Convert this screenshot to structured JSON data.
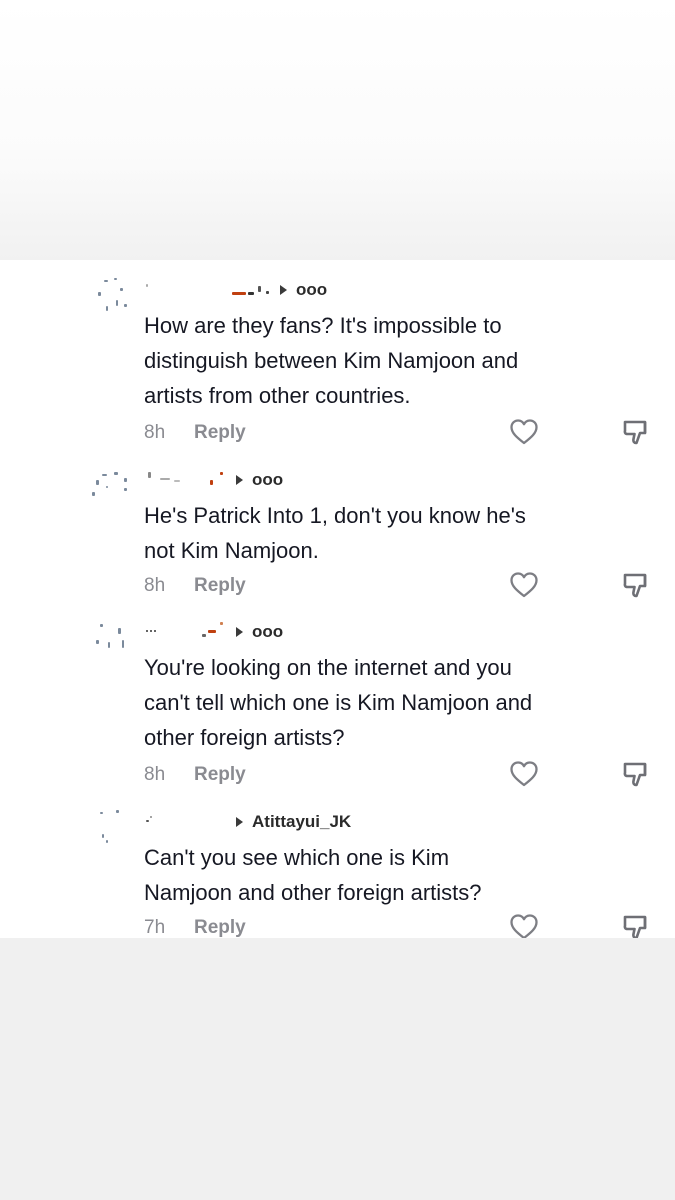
{
  "comments": [
    {
      "replying_to": "ooo",
      "text_lines": [
        "How are they fans? It's impossible to",
        "distinguish between Kim Namjoon and",
        "artists from other countries."
      ],
      "time": "8h",
      "reply_label": "Reply"
    },
    {
      "replying_to": "ooo",
      "text_lines": [
        "He's Patrick Into 1, don't you know he's",
        "not Kim Namjoon."
      ],
      "time": "8h",
      "reply_label": "Reply"
    },
    {
      "replying_to": "ooo",
      "text_lines": [
        "You're looking on the internet and you",
        "can't tell which one is Kim Namjoon and",
        "other foreign artists?"
      ],
      "time": "8h",
      "reply_label": "Reply"
    },
    {
      "replying_to": "Atittayui_JK",
      "text_lines": [
        "Can't you see which one is Kim",
        "Namjoon and other foreign artists?"
      ],
      "time": "7h",
      "reply_label": "Reply"
    }
  ],
  "icons": {
    "like": "heart-outline-icon",
    "dislike": "thumbs-down-outline-icon",
    "reply_marker": "triangle-right-icon"
  },
  "colors": {
    "text": "#161823",
    "meta": "#8a8b91",
    "username": "#2b2b2b",
    "background": "#f0f0f0",
    "card": "#ffffff"
  }
}
